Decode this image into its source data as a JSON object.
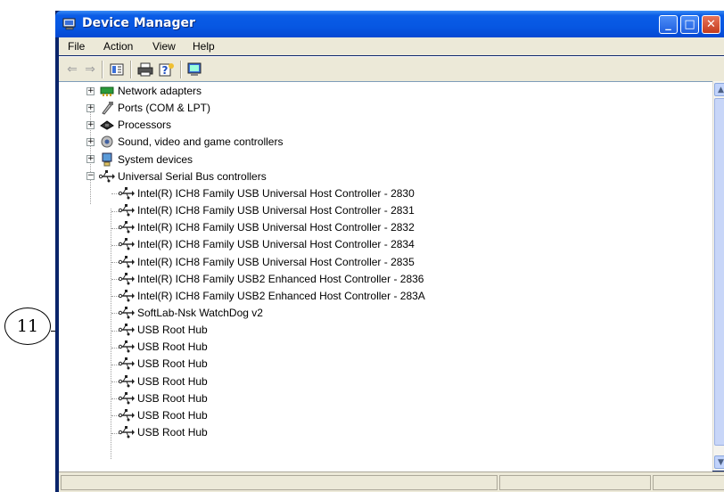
{
  "callout": {
    "label": "11"
  },
  "window": {
    "title": "Device Manager",
    "controls": {
      "minimize": "_",
      "maximize": "□",
      "close": "✕"
    }
  },
  "menubar": {
    "items": [
      "File",
      "Action",
      "View",
      "Help"
    ]
  },
  "toolbar": {
    "icons": [
      "back-arrow-icon",
      "forward-arrow-icon",
      "properties-icon",
      "print-icon",
      "help-icon",
      "scan-hardware-icon"
    ]
  },
  "tree": {
    "categories": [
      {
        "label": "Network adapters",
        "icon": "network-adapter-icon",
        "expanded": false
      },
      {
        "label": "Ports (COM & LPT)",
        "icon": "port-icon",
        "expanded": false
      },
      {
        "label": "Processors",
        "icon": "processor-icon",
        "expanded": false
      },
      {
        "label": "Sound, video and game controllers",
        "icon": "sound-icon",
        "expanded": false
      },
      {
        "label": "System devices",
        "icon": "system-device-icon",
        "expanded": false
      },
      {
        "label": "Universal Serial Bus controllers",
        "icon": "usb-icon",
        "expanded": true
      }
    ],
    "usb_children": [
      "Intel(R) ICH8 Family USB Universal Host Controller - 2830",
      "Intel(R) ICH8 Family USB Universal Host Controller - 2831",
      "Intel(R) ICH8 Family USB Universal Host Controller - 2832",
      "Intel(R) ICH8 Family USB Universal Host Controller - 2834",
      "Intel(R) ICH8 Family USB Universal Host Controller - 2835",
      "Intel(R) ICH8 Family USB2 Enhanced Host Controller - 2836",
      "Intel(R) ICH8 Family USB2 Enhanced Host Controller - 283A",
      "SoftLab-Nsk WatchDog v2",
      "USB Root Hub",
      "USB Root Hub",
      "USB Root Hub",
      "USB Root Hub",
      "USB Root Hub",
      "USB Root Hub",
      "USB Root Hub"
    ]
  },
  "colors": {
    "titlebar": "#0757e2",
    "chrome": "#ece9d8",
    "close_button": "#c43c1e"
  }
}
